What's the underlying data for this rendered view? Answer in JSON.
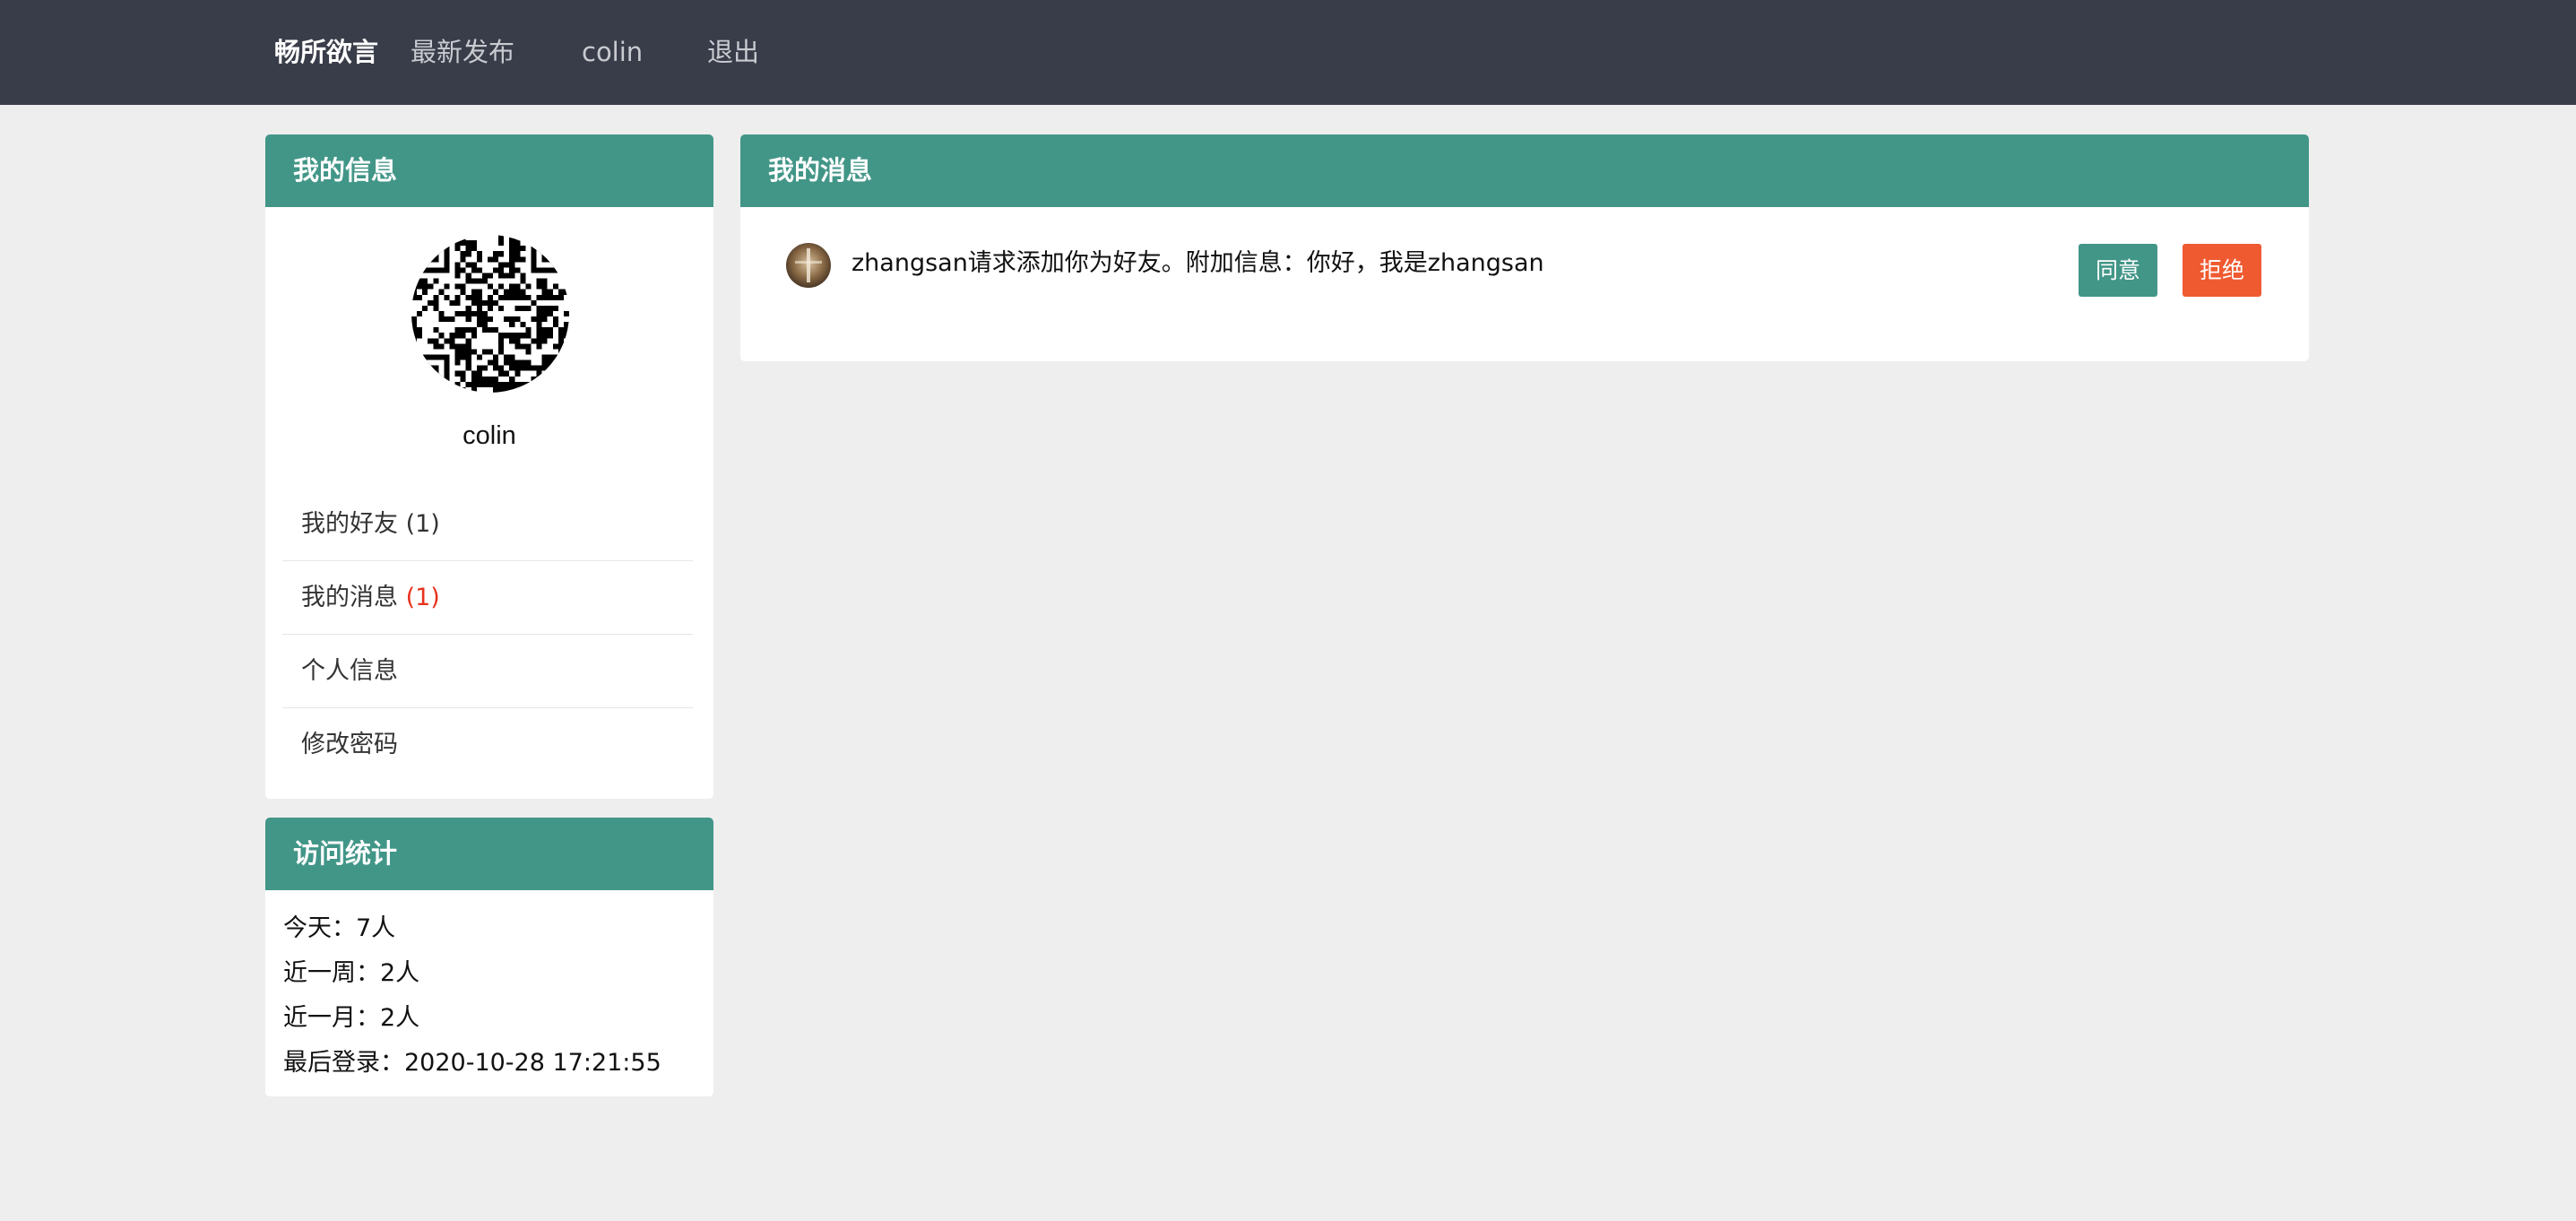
{
  "nav": {
    "brand": "畅所欲言",
    "latest": "最新发布",
    "user": "colin",
    "logout": "退出"
  },
  "my_info": {
    "title": "我的信息",
    "username": "colin",
    "menu": [
      {
        "label": "我的好友",
        "count": "(1)"
      },
      {
        "label": "我的消息",
        "count": "(1)"
      },
      {
        "label": "个人信息"
      },
      {
        "label": "修改密码"
      }
    ]
  },
  "stats": {
    "title": "访问统计",
    "lines": [
      "今天：7人",
      "近一周：2人",
      "近一月：2人",
      "最后登录：2020-10-28 17:21:55"
    ]
  },
  "messages": {
    "title": "我的消息",
    "items": [
      {
        "text": "zhangsan请求添加你为好友。附加信息：你好，我是zhangsan",
        "agree": "同意",
        "reject": "拒绝"
      }
    ]
  },
  "colors": {
    "nav_bg": "#393d49",
    "panel_header": "#429688",
    "agree": "#429688",
    "reject": "#f05a31",
    "badge_red": "#e8311c"
  }
}
